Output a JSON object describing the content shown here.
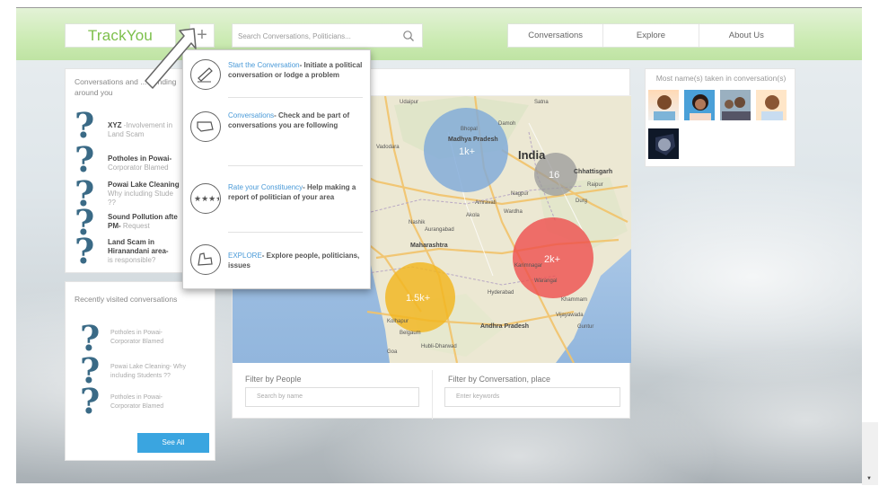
{
  "header": {
    "logo": "TrackYou",
    "plus_label": "+",
    "search_placeholder": "Search Conversations, Politicians...",
    "nav": [
      "Conversations",
      "Explore",
      "About Us"
    ]
  },
  "trending": {
    "title": "Conversations and ... trending around you",
    "items": [
      {
        "bold": "XYZ",
        "rest": " -Involvement in",
        "line2": "Land Scam"
      },
      {
        "bold": "Potholes in Powai-",
        "rest": "",
        "line2": "Corporator Blamed"
      },
      {
        "bold": "Powai Lake Cleaning",
        "rest": "",
        "line2": "Why including Stude",
        "line3": "??"
      },
      {
        "bold": "Sound Pollution afte",
        "rest": "",
        "line2": "PM-",
        "line2rest": " Request"
      },
      {
        "bold": "Land Scam in",
        "rest": "",
        "line2": "Hiranandani area-",
        "line3": "is responsible?"
      }
    ]
  },
  "recent": {
    "title": "Recently visited conversations",
    "items": [
      [
        "Potholes in Powai-",
        "Corporator Blamed"
      ],
      [
        "Powai Lake Cleaning- Why",
        "including Students ??"
      ],
      [
        "Potholes in Powai-",
        "Corporator Blamed"
      ]
    ],
    "see_all": "See All"
  },
  "map": {
    "places": {
      "udaipur": "Udaipur",
      "satna": "Satna",
      "damoh": "Damoh",
      "mp": "Madhya Pradesh",
      "india": "India",
      "chhattisgarh": "Chhattisgarh",
      "vadodara": "Vadodara",
      "nagpur": "Nagpur",
      "raipur": "Raipur",
      "amravati": "Amravati",
      "akola": "Akola",
      "wardha": "Wardha",
      "durg": "Durg",
      "nashik": "Nashik",
      "aurangabad": "Aurangabad",
      "maharashtra": "Maharashtra",
      "karimnagar": "Karimnagar",
      "warangal": "Warangal",
      "hyderabad": "Hyderabad",
      "khammam": "Khammam",
      "ap": "Andhra Pradesh",
      "vijayawada": "Vijayawada",
      "guntur": "Guntur",
      "kolhapur": "Kolhapur",
      "belgaum": "Belgaum",
      "hubli": "Hubli-Dharwad",
      "goa": "Goa",
      "bhopal": "Bhopal"
    },
    "bubbles": [
      {
        "label": "1k+",
        "color": "#7fa9d9"
      },
      {
        "label": "16",
        "color": "#9a9a9a"
      },
      {
        "label": "2k+",
        "color": "#ee4a4a"
      },
      {
        "label": "1.5k+",
        "color": "#f2b61e"
      }
    ],
    "filter_people": "Filter by People",
    "filter_people_placeholder": "Search by name",
    "filter_conv": "Filter by Conversation, place",
    "filter_conv_placeholder": "Enter keywords"
  },
  "names": {
    "title": "Most name(s) taken in conversation(s)"
  },
  "dropdown": {
    "items": [
      {
        "hl": "Start the Conversation",
        "rest": "- Initiate a political conversation or lodge a problem"
      },
      {
        "hl": "Conversations",
        "rest": "- Check and be part of conversations you are following"
      },
      {
        "hl": "Rate your Constituency",
        "rest": "- Help making a report of politician of your area"
      },
      {
        "hl": "EXPLORE",
        "rest": "- Explore people, politicians, issues"
      }
    ]
  }
}
